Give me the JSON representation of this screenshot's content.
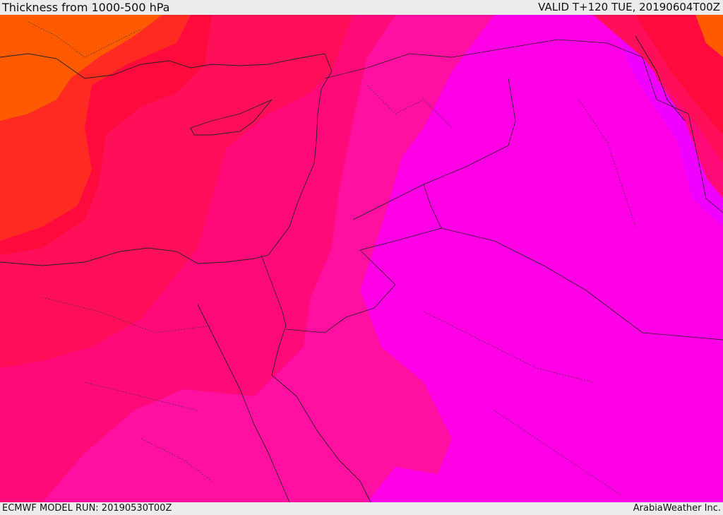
{
  "header": {
    "title": "Thickness from 1000-500 hPa",
    "valid_time": "VALID T+120 TUE, 20190604T00Z"
  },
  "footer": {
    "model_run": "ECMWF MODEL RUN: 20190530T00Z",
    "credit": "ArabiaWeather Inc."
  },
  "map": {
    "field": "1000-500 hPa thickness",
    "colors": {
      "orange": "#ff5a00",
      "orange_red": "#ff2a22",
      "red": "#ff0a3c",
      "crimson_pink": "#ff0e5a",
      "hot_pink": "#ff0a78",
      "pink_magenta": "#ff10a0",
      "magenta": "#ff00e6",
      "violet": "#f000ff"
    }
  }
}
